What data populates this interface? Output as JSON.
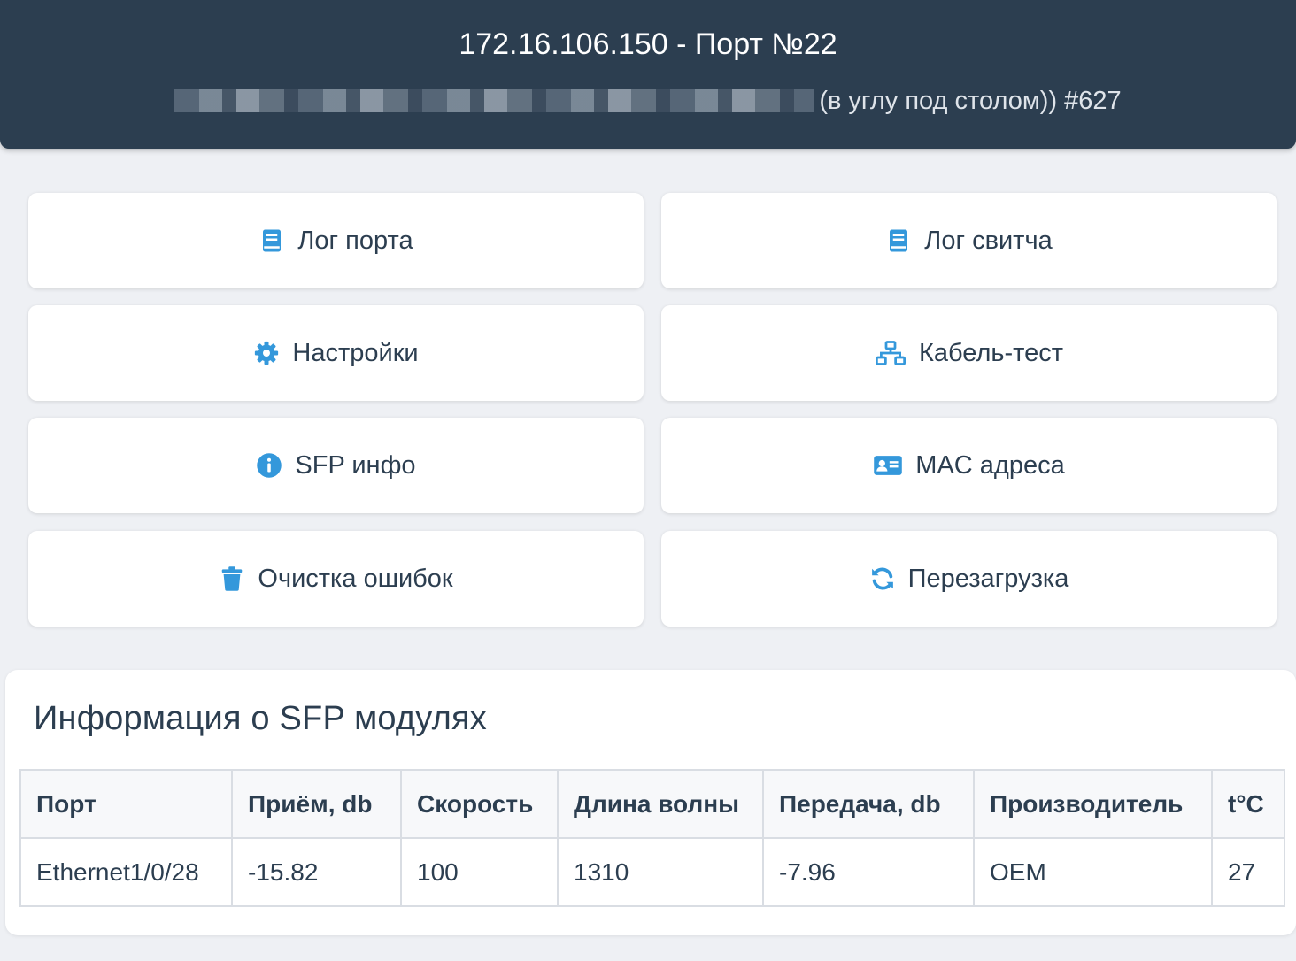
{
  "header": {
    "title": "172.16.106.150 - Порт №22",
    "subtitle_visible": "(в углу под столом)) #627"
  },
  "buttons": [
    {
      "label": "Лог порта",
      "icon": "book-icon"
    },
    {
      "label": "Лог свитча",
      "icon": "book-icon"
    },
    {
      "label": "Настройки",
      "icon": "gear-icon"
    },
    {
      "label": "Кабель-тест",
      "icon": "network-icon"
    },
    {
      "label": "SFP инфо",
      "icon": "info-icon"
    },
    {
      "label": "MAC адреса",
      "icon": "id-card-icon"
    },
    {
      "label": "Очистка ошибок",
      "icon": "trash-icon"
    },
    {
      "label": "Перезагрузка",
      "icon": "refresh-icon"
    }
  ],
  "sfp": {
    "heading": "Информация о SFP модулях",
    "columns": [
      "Порт",
      "Приём, db",
      "Скорость",
      "Длина волны",
      "Передача, db",
      "Производитель",
      "t°C"
    ],
    "rows": [
      [
        "Ethernet1/0/28",
        "-15.82",
        "100",
        "1310",
        "-7.96",
        "OEM",
        "27"
      ]
    ]
  },
  "colors": {
    "header_bg": "#2c3e50",
    "accent": "#3498db",
    "page_bg": "#eef0f4"
  }
}
